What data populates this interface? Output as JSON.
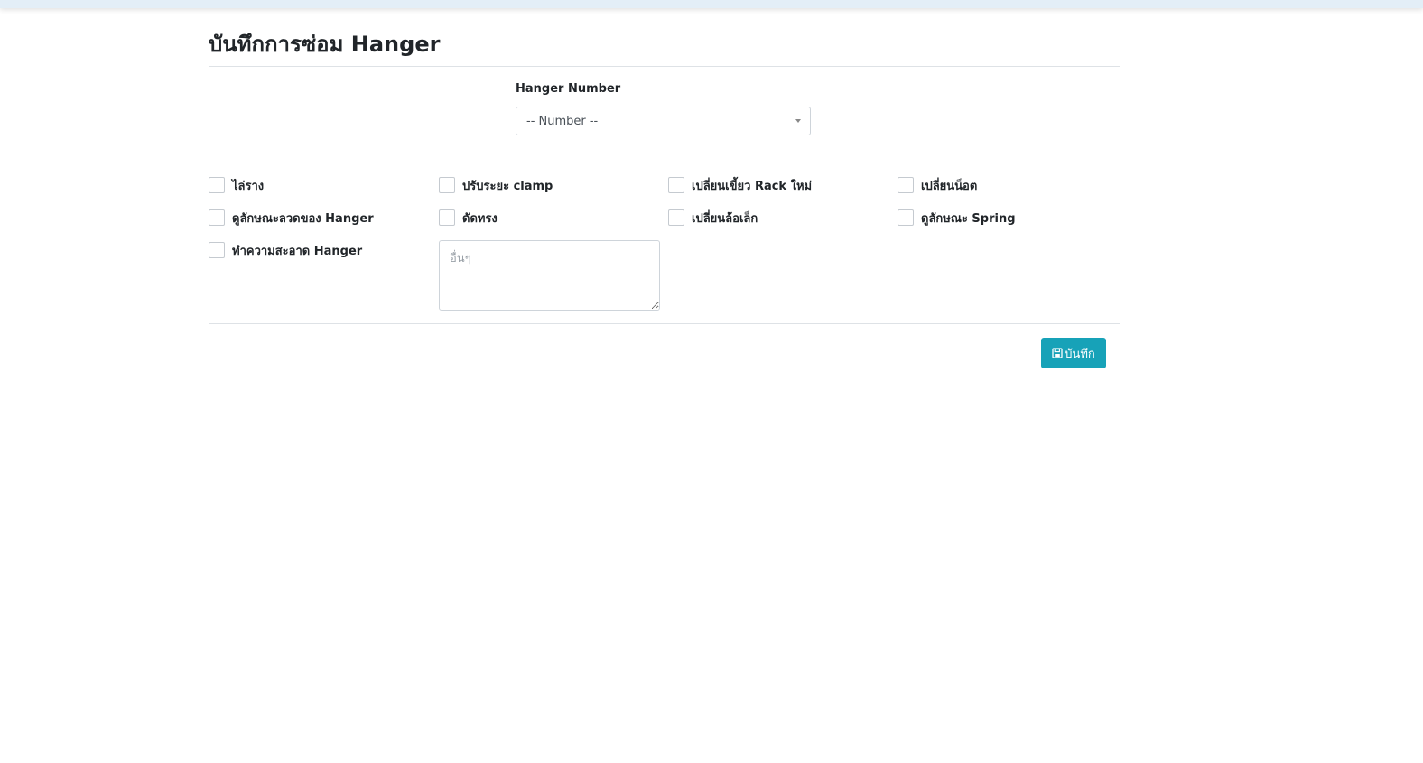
{
  "header": {
    "title": "บันทึกการซ่อม Hanger"
  },
  "form": {
    "hanger_number_label": "Hanger Number",
    "hanger_number_select": {
      "selected": "-- Number --"
    },
    "checkboxes": [
      {
        "label": "ไล่ราง",
        "checked": false
      },
      {
        "label": "ปรับระยะ clamp",
        "checked": false
      },
      {
        "label": "เปลี่ยนเขี้ยว Rack ใหม่",
        "checked": false
      },
      {
        "label": "เปลี่ยนน็อต",
        "checked": false
      },
      {
        "label": "ดูลักษณะลวดของ Hanger",
        "checked": false
      },
      {
        "label": "ดัดทรง",
        "checked": false
      },
      {
        "label": "เปลี่ยนล้อเล็ก",
        "checked": false
      },
      {
        "label": "ดูลักษณะ Spring",
        "checked": false
      },
      {
        "label": "ทำความสะอาด Hanger",
        "checked": false
      }
    ],
    "other_placeholder": "อื่นๆ",
    "save_label": "บันทึก"
  },
  "colors": {
    "accent": "#17a2b8",
    "topbar": "#e3eef7",
    "divider": "#dee2e6"
  },
  "icons": {
    "save": "floppy-disk-icon",
    "dropdown": "caret-down-icon"
  }
}
